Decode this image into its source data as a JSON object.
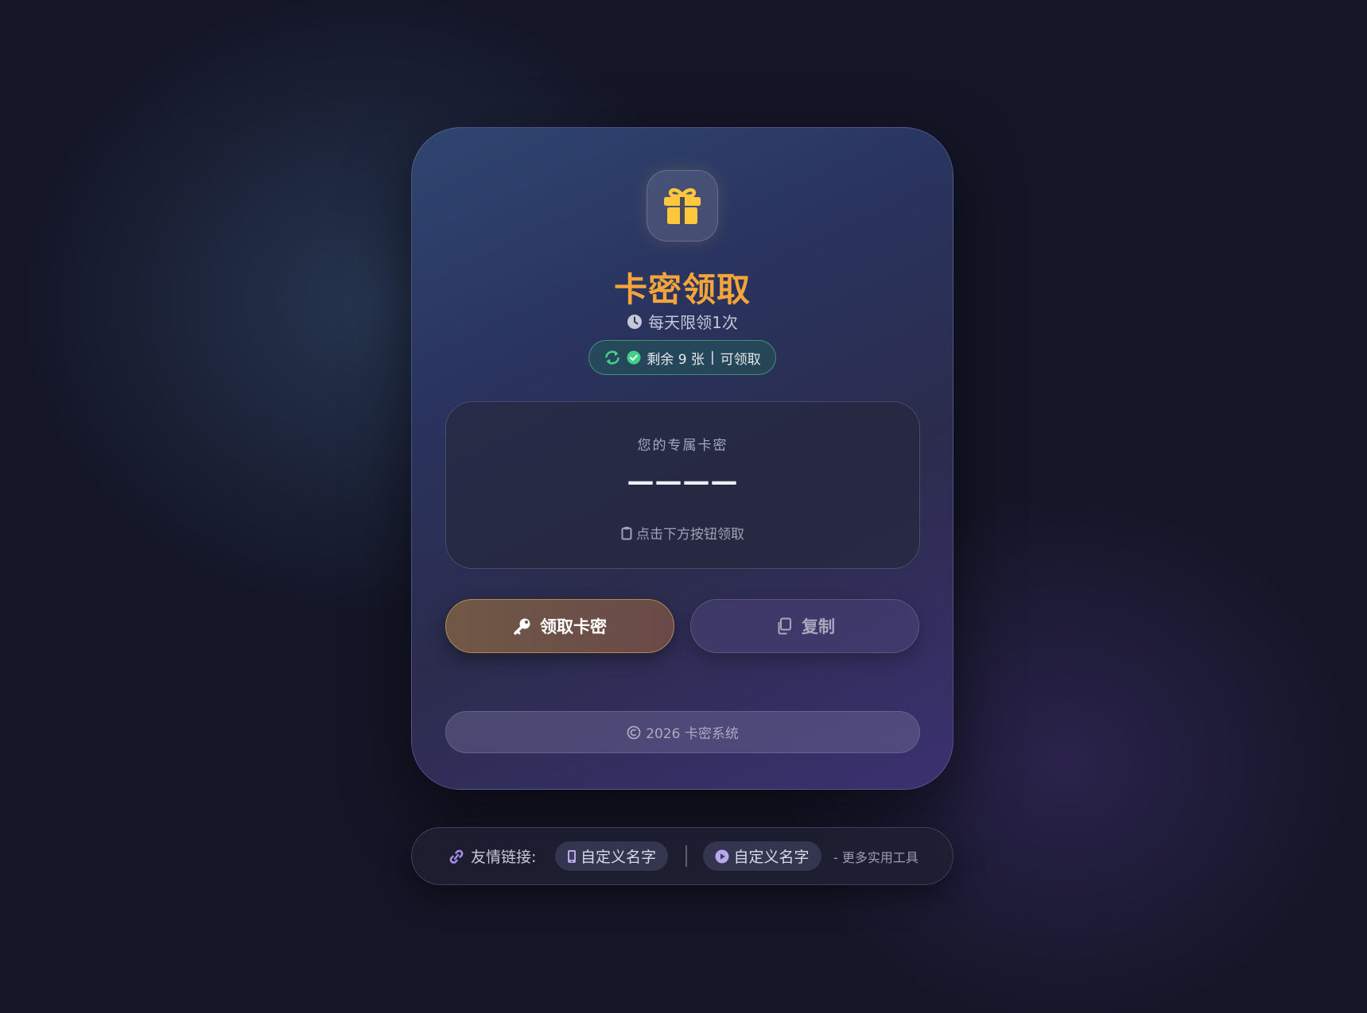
{
  "card": {
    "title": "卡密领取",
    "subtitle": "每天限领1次",
    "status": {
      "remaining": "剩余 9 张",
      "separator": "|",
      "state": "可领取"
    },
    "code_box": {
      "label": "您的专属卡密",
      "value": "————",
      "hint": "点击下方按钮领取"
    },
    "buttons": {
      "claim_label": "领取卡密",
      "copy_label": "复制"
    },
    "footer": {
      "text": "2026 卡密系统"
    }
  },
  "links": {
    "label": "友情链接:",
    "items": [
      {
        "label": "自定义名字",
        "icon": "mobile-icon"
      },
      {
        "label": "自定义名字",
        "icon": "play-circle-icon"
      }
    ],
    "more": "- 更多实用工具"
  },
  "colors": {
    "title": "#f3a43a",
    "gift_icon": "#ffc83c",
    "status_green": "#42d089",
    "link_icon": "#a98be8"
  }
}
